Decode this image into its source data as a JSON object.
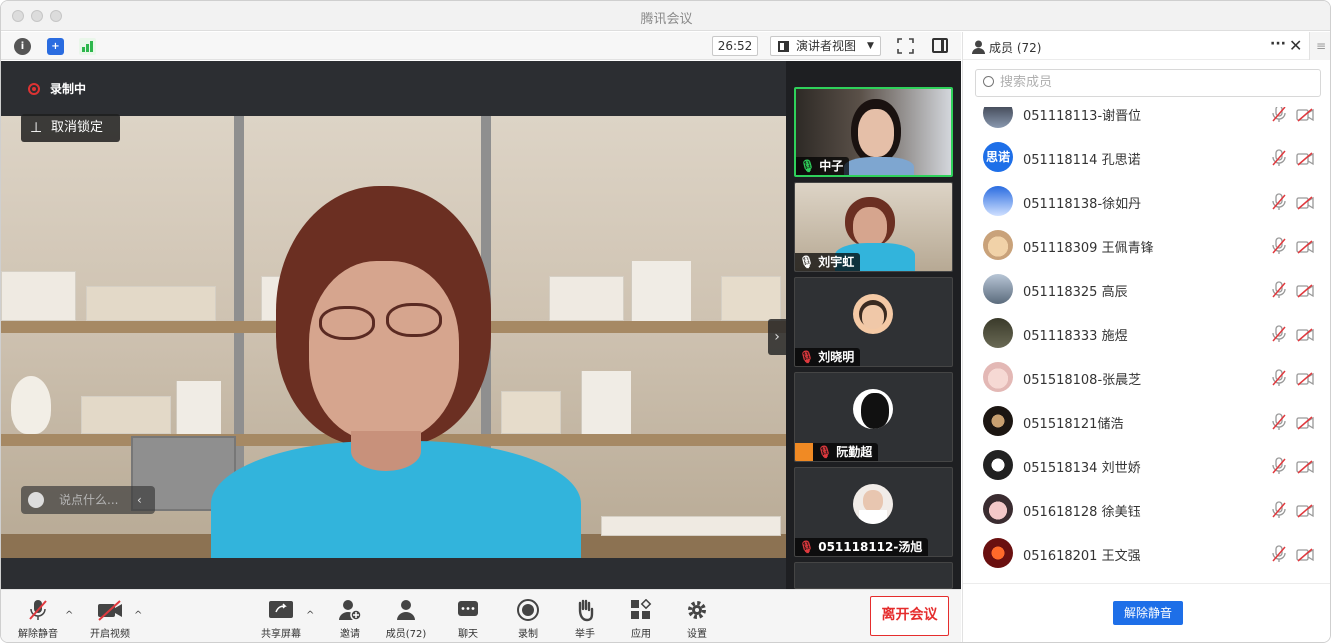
{
  "window": {
    "title": "腾讯会议"
  },
  "topbar": {
    "timer": "26:52",
    "view_label": "演讲者视图"
  },
  "video": {
    "recording_label": "录制中",
    "unpin_label": "取消锁定",
    "chat_placeholder": "说点什么..."
  },
  "tiles": [
    {
      "name": "中子",
      "speaking": true
    },
    {
      "name": "刘宇虹",
      "muted": false
    },
    {
      "name": "刘晓明",
      "muted": true
    },
    {
      "name": "阮勤超",
      "muted": true
    },
    {
      "name": "051118112-汤旭",
      "muted": true
    }
  ],
  "toolbar": {
    "unmute": "解除静音",
    "start_video": "开启视频",
    "share_screen": "共享屏幕",
    "invite": "邀请",
    "members": "成员(72)",
    "chat": "聊天",
    "record": "录制",
    "raise_hand": "举手",
    "apps": "应用",
    "settings": "设置",
    "leave": "离开会议"
  },
  "panel": {
    "title": "成员 (72)",
    "search_placeholder": "搜索成员",
    "unmute_all": "解除静音",
    "members": [
      {
        "name": "051118113-谢晋位"
      },
      {
        "name": "051118114 孔思诺",
        "avatar_text": "思诺"
      },
      {
        "name": "051118138-徐如丹"
      },
      {
        "name": "051118309 王佩青锋"
      },
      {
        "name": "051118325 高辰"
      },
      {
        "name": "051118333 施煜"
      },
      {
        "name": "051518108-张晨芝"
      },
      {
        "name": "051518121储浩"
      },
      {
        "name": "051518134 刘世娇"
      },
      {
        "name": "051618128 徐美钰"
      },
      {
        "name": "051618201 王文强"
      }
    ]
  },
  "colors": {
    "accent": "#1e6fe8",
    "leave": "#e52d2d",
    "active_speaker": "#2fd15b",
    "muted": "#e0393e"
  }
}
